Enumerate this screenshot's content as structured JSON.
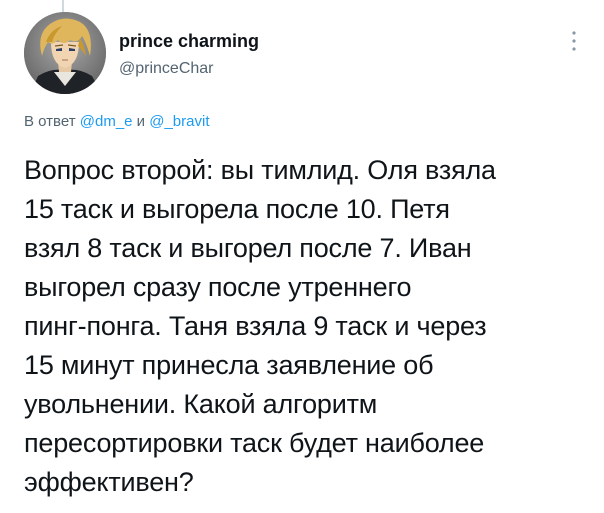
{
  "tweet": {
    "author": {
      "display_name": "prince charming",
      "handle": "@princeChar",
      "avatar_icon": "anime-character-avatar"
    },
    "more_icon": "more-vertical-icon",
    "reply": {
      "prefix": "В ответ",
      "mention_1": "@dm_e",
      "conjunction": "и",
      "mention_2": "@_bravit"
    },
    "text_lines": [
      "Вопрос второй: вы тимлид. Оля взяла",
      "15 таск и выгорела после 10. Петя",
      "взял 8 таск и выгорел после 7.  Иван",
      "выгорел сразу после утреннего",
      "пинг-понга. Таня взяла 9 таск и через",
      "15 минут принесла заявление об",
      "увольнении. Какой алгоритм",
      "пересортировки таск будет наиболее",
      "эффективен?"
    ]
  },
  "colors": {
    "text": "#0f1419",
    "secondary": "#536471",
    "link": "#1d9bf0",
    "divider": "#cfd9de"
  }
}
